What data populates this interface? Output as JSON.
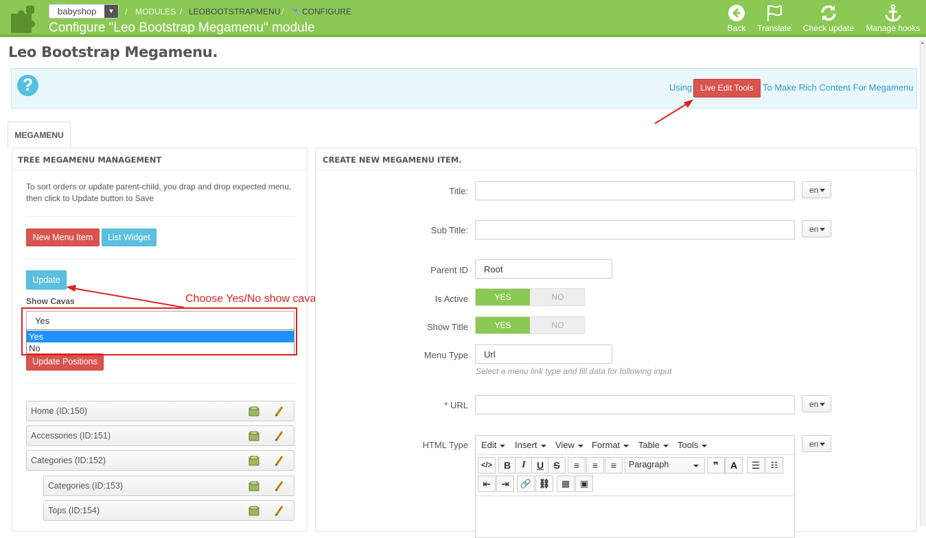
{
  "topbar": {
    "shop_selector": "babyshop",
    "breadcrumbs": [
      "MODULES",
      "LEOBOOTSTRAPMENU",
      "CONFIGURE"
    ],
    "page_heading": "Configure \"Leo Bootstrap Megamenu\" module",
    "toolbar": [
      {
        "label": "Back",
        "icon": "back-arrow-icon"
      },
      {
        "label": "Translate",
        "icon": "flag-icon"
      },
      {
        "label": "Check update",
        "icon": "refresh-icon"
      },
      {
        "label": "Manage hooks",
        "icon": "anchor-icon"
      }
    ],
    "colors": {
      "bar": "#8bc954",
      "danger": "#d9534f",
      "info": "#5bc0de"
    }
  },
  "module_title": "Leo Bootstrap Megamenu.",
  "info": {
    "icon": "question-icon",
    "prefix": "Using",
    "button": "Live Edit Tools",
    "suffix": "To Make Rich Content For Megamenu"
  },
  "tab": "MEGAMENU",
  "tree": {
    "heading": "TREE MEGAMENU MANAGEMENT",
    "hint": "To sort orders or update parent-child, you drap and drop expected menu, then click to Update button to Save",
    "new_item_button": "New Menu Item",
    "list_widget_button": "List Widget",
    "update_button": "Update",
    "show_cavas_label": "Show Cavas",
    "show_cavas_value": "Yes",
    "show_cavas_options": [
      "Yes",
      "No"
    ],
    "update_positions_button": "Update Positions",
    "items": [
      {
        "label": "Home (ID:150)",
        "level": 0
      },
      {
        "label": "Accessories (ID:151)",
        "level": 0
      },
      {
        "label": "Categories (ID:152)",
        "level": 0
      },
      {
        "label": "Categories (ID:153)",
        "level": 1
      },
      {
        "label": "Tops (ID:154)",
        "level": 1
      }
    ]
  },
  "form": {
    "heading": "CREATE NEW MEGAMENU ITEM.",
    "title_label": "Title:",
    "subtitle_label": "Sub Title:",
    "parent_label": "Parent ID",
    "parent_value": "Root",
    "active_label": "Is Active",
    "showtitle_label": "Show Title",
    "yes": "YES",
    "no": "NO",
    "menutype_label": "Menu Type",
    "menutype_value": "Url",
    "menutype_hint": "Select a menu link type and fill data for following input",
    "url_required": "*",
    "url_label": "URL",
    "htmltype_label": "HTML Type",
    "lang": "en",
    "editor_menu": [
      "Edit",
      "Insert",
      "View",
      "Format",
      "Table",
      "Tools"
    ],
    "paragraph": "Paragraph"
  },
  "annotation": "Choose Yes/No show cavas"
}
